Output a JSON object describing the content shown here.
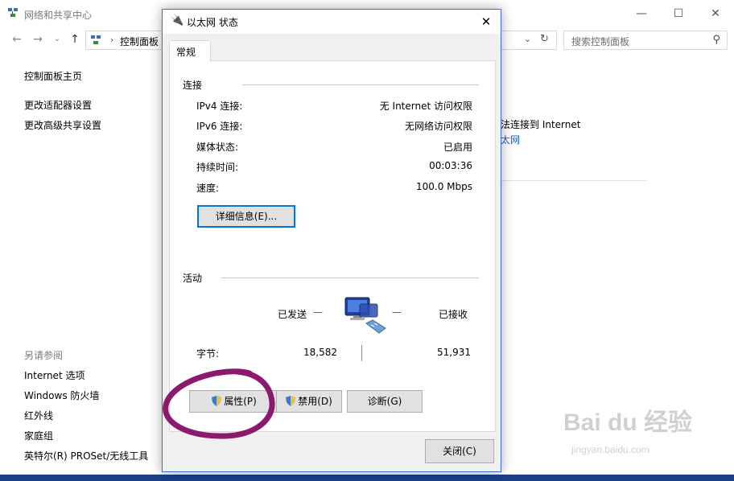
{
  "background_window": {
    "title": "网络和共享中心",
    "controls": {
      "minimize": "—",
      "maximize": "☐",
      "close": "✕"
    },
    "address": {
      "separator": "›",
      "path": "控制面板"
    },
    "search": {
      "placeholder": "搜索控制面板"
    },
    "left_nav": {
      "home": "控制面板主页",
      "adapter_settings": "更改适配器设置",
      "advanced_sharing": "更改高级共享设置",
      "see_also_label": "另请参阅",
      "see_also": [
        "Internet 选项",
        "Windows 防火墙",
        "红外线",
        "家庭组",
        "英特尔(R) PROSet/无线工具"
      ]
    },
    "right_partial": {
      "line1": "法连接到 Internet",
      "line2": "太网"
    }
  },
  "dialog": {
    "title": "以太网 状态",
    "close_glyph": "✕",
    "tab_general": "常规",
    "connection": {
      "heading": "连接",
      "rows": [
        {
          "label": "IPv4 连接:",
          "value": "无 Internet 访问权限"
        },
        {
          "label": "IPv6 连接:",
          "value": "无网络访问权限"
        },
        {
          "label": "媒体状态:",
          "value": "已启用"
        },
        {
          "label": "持续时间:",
          "value": "00:03:36"
        },
        {
          "label": "速度:",
          "value": "100.0 Mbps"
        }
      ],
      "details_button": "详细信息(E)..."
    },
    "activity": {
      "heading": "活动",
      "sent_label": "已发送",
      "received_label": "已接收",
      "dash": "—",
      "bytes_label": "字节:",
      "bytes_sent": "18,582",
      "bytes_received": "51,931"
    },
    "buttons": {
      "properties": "属性(P)",
      "disable": "禁用(D)",
      "diagnose": "诊断(G)",
      "close": "关闭(C)"
    }
  },
  "watermark": {
    "brand": "Bai du 经验",
    "url": "jingyan.baidu.com"
  },
  "colors": {
    "accent_blue": "#0078d7",
    "annotation": "#8b1a6f",
    "link_blue": "#1a5cc8"
  }
}
